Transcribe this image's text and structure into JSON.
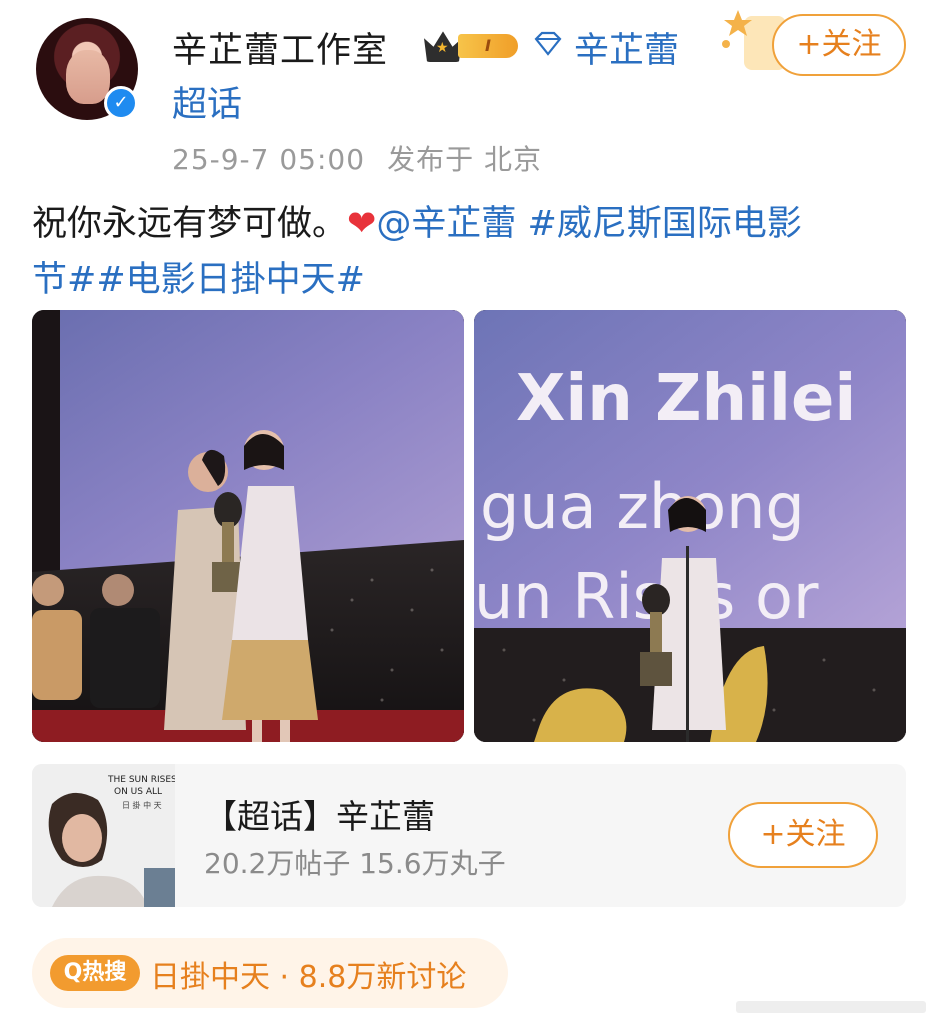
{
  "header": {
    "username": "辛芷蕾工作室",
    "vip_level": "I",
    "supertopic_link_line1": "辛芷蕾",
    "supertopic_link_line2": "超话",
    "follow_label": "+关注",
    "timestamp": "25-9-7 05:00",
    "location": "发布于 北京"
  },
  "post": {
    "text_plain": "祝你永远有梦可做。",
    "heart": "❤",
    "mention": "@辛芷蕾",
    "hashtag1_part1": "#威尼斯国际电影",
    "hashtag1_part2": "节#",
    "hashtag2": "#电影日掛中天#"
  },
  "images": {
    "left": {
      "subject": "award ceremony on stage"
    },
    "right": {
      "screen_line1": "Xin Zhilei",
      "screen_line2": "gua zhong",
      "screen_line3": "un Rises or"
    }
  },
  "supertopic_card": {
    "title": "【超话】辛芷蕾",
    "stats": "20.2万帖子 15.6万丸子",
    "follow_label": "+关注",
    "poster_title1": "THE SUN RISES",
    "poster_title2": "ON US ALL",
    "poster_sub": "日 掛 中 天"
  },
  "hot_search": {
    "tag": "Q热搜",
    "topic": "日掛中天",
    "count": "· 8.8万新讨论"
  },
  "colors": {
    "link": "#2a6fc1",
    "accent": "#e6801e",
    "meta": "#9a9a9a"
  }
}
